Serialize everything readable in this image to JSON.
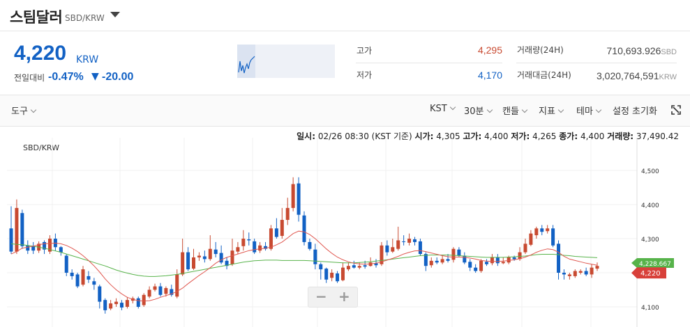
{
  "header": {
    "name": "스팀달러",
    "pair": "SBD/KRW"
  },
  "price": {
    "value": "4,220",
    "unit": "KRW"
  },
  "change": {
    "label": "전일대비",
    "rate": "-0.47%",
    "arrow": "▼",
    "amount": "-20.00"
  },
  "stats": {
    "high_label": "고가",
    "high_value": "4,295",
    "low_label": "저가",
    "low_value": "4,170",
    "volume_label": "거래량(24H)",
    "volume_value": "710,693.926",
    "volume_unit": "SBD",
    "amount_label": "거래대금(24H)",
    "amount_value": "3,020,764,591",
    "amount_unit": "KRW"
  },
  "toolbar": {
    "tools": "도구",
    "timezone": "KST",
    "interval": "30분",
    "candle": "캔들",
    "indicator": "지표",
    "theme": "테마",
    "reset": "설정 초기화"
  },
  "info_line": {
    "time_label": "일시:",
    "time_value": "02/26 08:30 (KST 기준)",
    "open_label": "시가:",
    "open_value": "4,305",
    "high_label": "고가:",
    "high_value": "4,400",
    "low_label": "저가:",
    "low_value": "4,265",
    "close_label": "종가:",
    "close_value": "4,400",
    "volume_label": "거래량:",
    "volume_value": "37,490.42"
  },
  "colors": {
    "up": "#c84a31",
    "down": "#1261c4",
    "ma_fast": "#e0574f",
    "ma_slow": "#57b34a"
  },
  "chart_data": {
    "type": "candlestick",
    "title": "SBD/KRW",
    "ylim": [
      4075,
      4555
    ],
    "yticks": [
      "4,100",
      "4,200",
      "4,300",
      "4,400",
      "4,500"
    ],
    "ytick_values": [
      4100,
      4200,
      4300,
      4400,
      4500
    ],
    "last_price_label": "4,220",
    "ma_label_partial": "4,228.667",
    "candles": [
      [
        4330,
        4262,
        4395,
        4255
      ],
      [
        4262,
        4390,
        4415,
        4255
      ],
      [
        4375,
        4278,
        4385,
        4270
      ],
      [
        4280,
        4265,
        4295,
        4255
      ],
      [
        4278,
        4265,
        4290,
        4255
      ],
      [
        4265,
        4285,
        4292,
        4258
      ],
      [
        4290,
        4268,
        4295,
        4255
      ],
      [
        4262,
        4300,
        4310,
        4255
      ],
      [
        4300,
        4275,
        4315,
        4265
      ],
      [
        4275,
        4260,
        4278,
        4250
      ],
      [
        4250,
        4200,
        4255,
        4190
      ],
      [
        4200,
        4190,
        4210,
        4180
      ],
      [
        4195,
        4160,
        4200,
        4155
      ],
      [
        4165,
        4210,
        4220,
        4160
      ],
      [
        4190,
        4180,
        4205,
        4170
      ],
      [
        4175,
        4165,
        4185,
        4150
      ],
      [
        4160,
        4115,
        4165,
        4095
      ],
      [
        4120,
        4090,
        4125,
        4080
      ],
      [
        4095,
        4110,
        4120,
        4090
      ],
      [
        4108,
        4115,
        4125,
        4100
      ],
      [
        4112,
        4098,
        4120,
        4090
      ],
      [
        4100,
        4120,
        4128,
        4095
      ],
      [
        4118,
        4125,
        4130,
        4110
      ],
      [
        4125,
        4100,
        4130,
        4095
      ],
      [
        4105,
        4135,
        4140,
        4100
      ],
      [
        4130,
        4150,
        4160,
        4125
      ],
      [
        4150,
        4160,
        4168,
        4145
      ],
      [
        4160,
        4135,
        4170,
        4130
      ],
      [
        4138,
        4155,
        4160,
        4130
      ],
      [
        4152,
        4135,
        4165,
        4130
      ],
      [
        4130,
        4195,
        4210,
        4125
      ],
      [
        4195,
        4260,
        4300,
        4190
      ],
      [
        4260,
        4210,
        4275,
        4205
      ],
      [
        4212,
        4245,
        4270,
        4208
      ],
      [
        4245,
        4250,
        4260,
        4235
      ],
      [
        4248,
        4240,
        4265,
        4230
      ],
      [
        4240,
        4270,
        4310,
        4235
      ],
      [
        4268,
        4255,
        4290,
        4245
      ],
      [
        4258,
        4230,
        4280,
        4225
      ],
      [
        4235,
        4220,
        4245,
        4210
      ],
      [
        4225,
        4265,
        4300,
        4220
      ],
      [
        4262,
        4275,
        4290,
        4255
      ],
      [
        4278,
        4300,
        4325,
        4265
      ],
      [
        4298,
        4295,
        4318,
        4280
      ],
      [
        4292,
        4260,
        4300,
        4255
      ],
      [
        4265,
        4280,
        4290,
        4258
      ],
      [
        4278,
        4270,
        4290,
        4265
      ],
      [
        4270,
        4330,
        4340,
        4265
      ],
      [
        4330,
        4305,
        4360,
        4300
      ],
      [
        4308,
        4355,
        4390,
        4300
      ],
      [
        4355,
        4390,
        4420,
        4340
      ],
      [
        4390,
        4460,
        4480,
        4380
      ],
      [
        4462,
        4370,
        4480,
        4350
      ],
      [
        4368,
        4290,
        4380,
        4280
      ],
      [
        4290,
        4270,
        4300,
        4265
      ],
      [
        4268,
        4225,
        4285,
        4210
      ],
      [
        4225,
        4210,
        4230,
        4180
      ],
      [
        4212,
        4180,
        4215,
        4170
      ],
      [
        4185,
        4200,
        4210,
        4175
      ],
      [
        4198,
        4175,
        4205,
        4170
      ],
      [
        4178,
        4215,
        4230,
        4175
      ],
      [
        4210,
        4220,
        4230,
        4205
      ],
      [
        4222,
        4215,
        4235,
        4212
      ],
      [
        4215,
        4220,
        4230,
        4210
      ],
      [
        4222,
        4218,
        4235,
        4212
      ],
      [
        4220,
        4230,
        4245,
        4218
      ],
      [
        4228,
        4222,
        4240,
        4215
      ],
      [
        4225,
        4280,
        4290,
        4220
      ],
      [
        4280,
        4260,
        4295,
        4250
      ],
      [
        4262,
        4275,
        4300,
        4258
      ],
      [
        4270,
        4295,
        4335,
        4265
      ],
      [
        4292,
        4290,
        4310,
        4280
      ],
      [
        4288,
        4300,
        4315,
        4280
      ],
      [
        4298,
        4290,
        4305,
        4280
      ],
      [
        4292,
        4255,
        4300,
        4250
      ],
      [
        4255,
        4220,
        4260,
        4205
      ],
      [
        4222,
        4235,
        4245,
        4215
      ],
      [
        4235,
        4230,
        4245,
        4225
      ],
      [
        4230,
        4240,
        4250,
        4225
      ],
      [
        4240,
        4235,
        4255,
        4230
      ],
      [
        4238,
        4270,
        4275,
        4230
      ],
      [
        4268,
        4250,
        4275,
        4245
      ],
      [
        4250,
        4230,
        4260,
        4225
      ],
      [
        4232,
        4215,
        4240,
        4205
      ],
      [
        4215,
        4205,
        4225,
        4200
      ],
      [
        4205,
        4235,
        4240,
        4200
      ],
      [
        4232,
        4225,
        4240,
        4220
      ],
      [
        4228,
        4245,
        4255,
        4222
      ],
      [
        4245,
        4228,
        4255,
        4220
      ],
      [
        4228,
        4232,
        4245,
        4225
      ],
      [
        4230,
        4245,
        4250,
        4225
      ],
      [
        4245,
        4240,
        4250,
        4235
      ],
      [
        4240,
        4260,
        4275,
        4235
      ],
      [
        4260,
        4285,
        4300,
        4255
      ],
      [
        4282,
        4315,
        4325,
        4278
      ],
      [
        4310,
        4330,
        4335,
        4300
      ],
      [
        4330,
        4320,
        4340,
        4310
      ],
      [
        4322,
        4330,
        4340,
        4315
      ],
      [
        4330,
        4280,
        4340,
        4275
      ],
      [
        4285,
        4200,
        4295,
        4180
      ],
      [
        4200,
        4195,
        4210,
        4180
      ],
      [
        4190,
        4195,
        4200,
        4180
      ],
      [
        4190,
        4205,
        4210,
        4185
      ],
      [
        4200,
        4205,
        4210,
        4195
      ],
      [
        4205,
        4195,
        4215,
        4190
      ],
      [
        4195,
        4215,
        4225,
        4185
      ],
      [
        4212,
        4220,
        4230,
        4205
      ]
    ],
    "ma_fast": [
      4255,
      4262,
      4272,
      4275,
      4278,
      4282,
      4285,
      4286,
      4287,
      4285,
      4280,
      4272,
      4262,
      4250,
      4236,
      4220,
      4202,
      4182,
      4165,
      4150,
      4138,
      4128,
      4122,
      4118,
      4117,
      4118,
      4122,
      4128,
      4133,
      4138,
      4145,
      4155,
      4168,
      4180,
      4192,
      4203,
      4215,
      4228,
      4238,
      4245,
      4250,
      4255,
      4260,
      4265,
      4268,
      4270,
      4272,
      4275,
      4282,
      4290,
      4302,
      4315,
      4322,
      4320,
      4312,
      4300,
      4285,
      4270,
      4257,
      4246,
      4238,
      4232,
      4228,
      4226,
      4225,
      4226,
      4228,
      4232,
      4237,
      4242,
      4248,
      4255,
      4260,
      4264,
      4265,
      4262,
      4258,
      4254,
      4250,
      4247,
      4246,
      4246,
      4245,
      4243,
      4240,
      4236,
      4234,
      4233,
      4233,
      4234,
      4236,
      4238,
      4241,
      4246,
      4252,
      4260,
      4266,
      4270,
      4268,
      4260,
      4248,
      4240,
      4236,
      4232,
      4228,
      4225,
      4222
    ],
    "ma_slow": [
      4285,
      4283,
      4282,
      4280,
      4278,
      4275,
      4272,
      4268,
      4264,
      4260,
      4255,
      4250,
      4245,
      4240,
      4235,
      4230,
      4225,
      4220,
      4214,
      4208,
      4203,
      4199,
      4195,
      4192,
      4190,
      4189,
      4189,
      4190,
      4191,
      4193,
      4195,
      4198,
      4201,
      4204,
      4207,
      4210,
      4213,
      4216,
      4219,
      4222,
      4225,
      4228,
      4231,
      4233,
      4235,
      4236,
      4237,
      4237,
      4237,
      4236,
      4236,
      4236,
      4236,
      4236,
      4235,
      4234,
      4233,
      4232,
      4231,
      4230,
      4229,
      4229,
      4229,
      4230,
      4231,
      4232,
      4234,
      4236,
      4238,
      4240,
      4242,
      4244,
      4246,
      4248,
      4250,
      4251,
      4252,
      4252,
      4252,
      4252,
      4251,
      4250,
      4249,
      4248,
      4247,
      4246,
      4245,
      4245,
      4245,
      4245,
      4246,
      4247,
      4248,
      4249,
      4251,
      4253,
      4254,
      4254,
      4254,
      4253,
      4251,
      4250,
      4248,
      4247,
      4246,
      4245,
      4244
    ]
  }
}
